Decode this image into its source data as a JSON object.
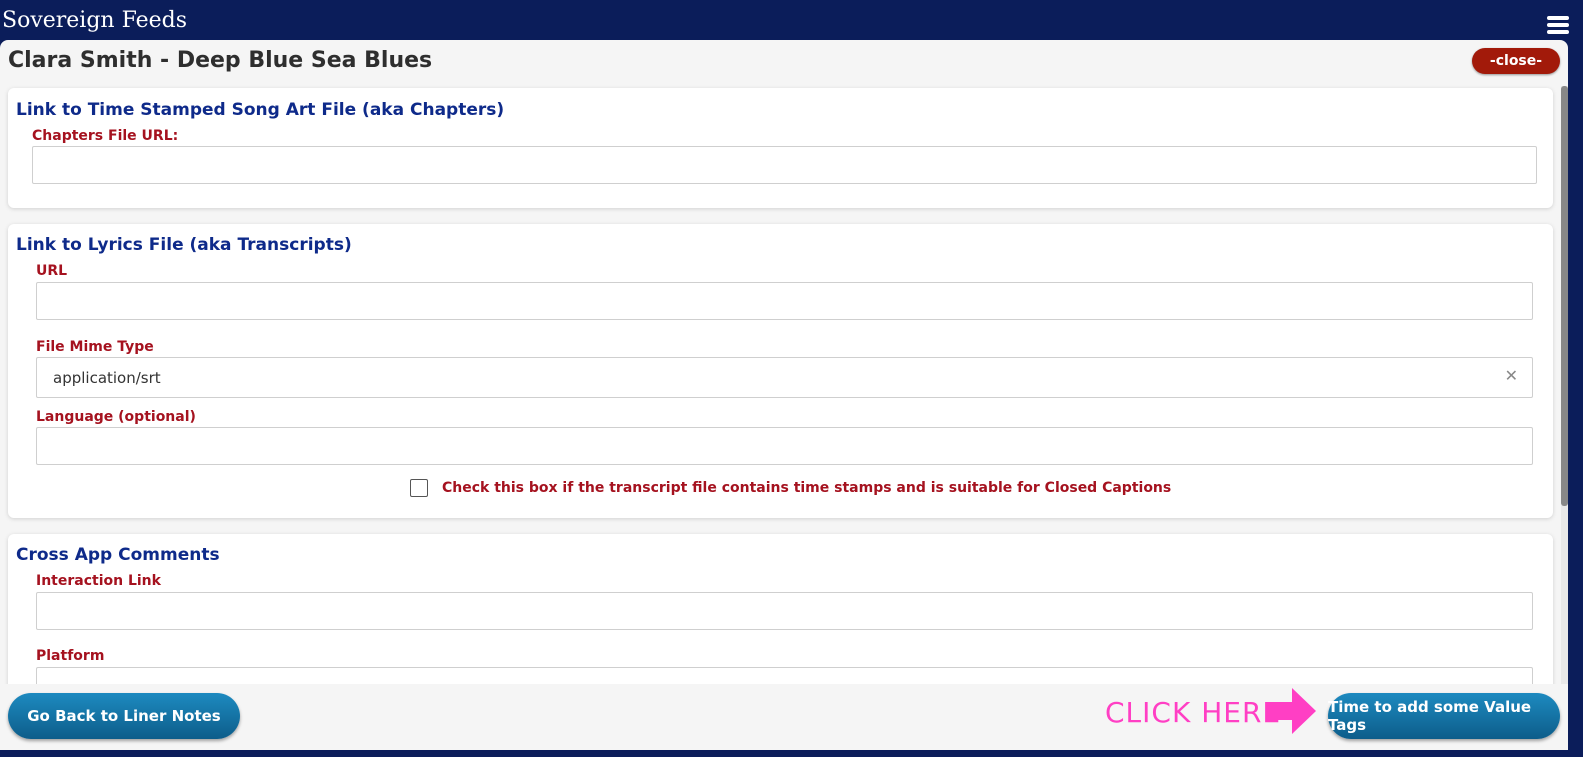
{
  "app": {
    "title": "Sovereign Feeds"
  },
  "page": {
    "title": "Clara Smith - Deep Blue Sea Blues",
    "close_label": "-close-"
  },
  "sections": {
    "chapters": {
      "title": "Link to Time Stamped Song Art File (aka Chapters)",
      "url_label": "Chapters File URL:",
      "url_value": ""
    },
    "transcripts": {
      "title": "Link to Lyrics File (aka Transcripts)",
      "url_label": "URL",
      "url_value": "",
      "mime_label": "File Mime Type",
      "mime_value": "application/srt",
      "language_label": "Language (optional)",
      "language_value": "",
      "captions_checkbox_label": "Check this box if the transcript file contains time stamps and is suitable for Closed Captions",
      "captions_checked": false
    },
    "comments": {
      "title": "Cross App Comments",
      "interaction_label": "Interaction Link",
      "interaction_value": "",
      "platform_label": "Platform"
    }
  },
  "footer": {
    "back_label": "Go Back to Liner Notes",
    "hint_text": "CLICK HERE",
    "next_label": "Time to add some Value Tags"
  },
  "colors": {
    "header_bg": "#0b1d5a",
    "section_title": "#0e2a8a",
    "field_label": "#a5121f",
    "close_button": "#a21a0a",
    "hint": "#ff3fc4"
  },
  "icons": [
    "hamburger-menu-icon",
    "clear-x-icon",
    "right-arrow-icon",
    "chevron-down-icon"
  ]
}
